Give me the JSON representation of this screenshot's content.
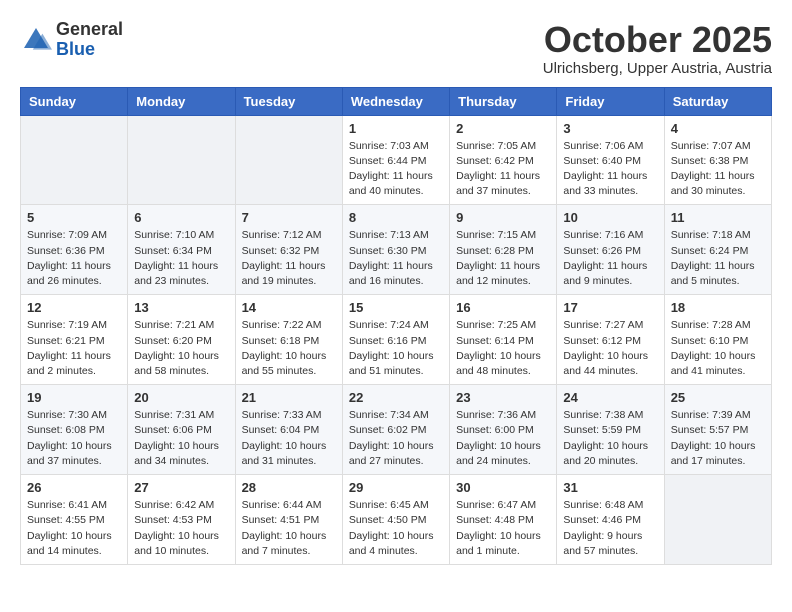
{
  "header": {
    "logo_general": "General",
    "logo_blue": "Blue",
    "month": "October 2025",
    "location": "Ulrichsberg, Upper Austria, Austria"
  },
  "weekdays": [
    "Sunday",
    "Monday",
    "Tuesday",
    "Wednesday",
    "Thursday",
    "Friday",
    "Saturday"
  ],
  "weeks": [
    [
      {
        "day": "",
        "info": ""
      },
      {
        "day": "",
        "info": ""
      },
      {
        "day": "",
        "info": ""
      },
      {
        "day": "1",
        "info": "Sunrise: 7:03 AM\nSunset: 6:44 PM\nDaylight: 11 hours\nand 40 minutes."
      },
      {
        "day": "2",
        "info": "Sunrise: 7:05 AM\nSunset: 6:42 PM\nDaylight: 11 hours\nand 37 minutes."
      },
      {
        "day": "3",
        "info": "Sunrise: 7:06 AM\nSunset: 6:40 PM\nDaylight: 11 hours\nand 33 minutes."
      },
      {
        "day": "4",
        "info": "Sunrise: 7:07 AM\nSunset: 6:38 PM\nDaylight: 11 hours\nand 30 minutes."
      }
    ],
    [
      {
        "day": "5",
        "info": "Sunrise: 7:09 AM\nSunset: 6:36 PM\nDaylight: 11 hours\nand 26 minutes."
      },
      {
        "day": "6",
        "info": "Sunrise: 7:10 AM\nSunset: 6:34 PM\nDaylight: 11 hours\nand 23 minutes."
      },
      {
        "day": "7",
        "info": "Sunrise: 7:12 AM\nSunset: 6:32 PM\nDaylight: 11 hours\nand 19 minutes."
      },
      {
        "day": "8",
        "info": "Sunrise: 7:13 AM\nSunset: 6:30 PM\nDaylight: 11 hours\nand 16 minutes."
      },
      {
        "day": "9",
        "info": "Sunrise: 7:15 AM\nSunset: 6:28 PM\nDaylight: 11 hours\nand 12 minutes."
      },
      {
        "day": "10",
        "info": "Sunrise: 7:16 AM\nSunset: 6:26 PM\nDaylight: 11 hours\nand 9 minutes."
      },
      {
        "day": "11",
        "info": "Sunrise: 7:18 AM\nSunset: 6:24 PM\nDaylight: 11 hours\nand 5 minutes."
      }
    ],
    [
      {
        "day": "12",
        "info": "Sunrise: 7:19 AM\nSunset: 6:21 PM\nDaylight: 11 hours\nand 2 minutes."
      },
      {
        "day": "13",
        "info": "Sunrise: 7:21 AM\nSunset: 6:20 PM\nDaylight: 10 hours\nand 58 minutes."
      },
      {
        "day": "14",
        "info": "Sunrise: 7:22 AM\nSunset: 6:18 PM\nDaylight: 10 hours\nand 55 minutes."
      },
      {
        "day": "15",
        "info": "Sunrise: 7:24 AM\nSunset: 6:16 PM\nDaylight: 10 hours\nand 51 minutes."
      },
      {
        "day": "16",
        "info": "Sunrise: 7:25 AM\nSunset: 6:14 PM\nDaylight: 10 hours\nand 48 minutes."
      },
      {
        "day": "17",
        "info": "Sunrise: 7:27 AM\nSunset: 6:12 PM\nDaylight: 10 hours\nand 44 minutes."
      },
      {
        "day": "18",
        "info": "Sunrise: 7:28 AM\nSunset: 6:10 PM\nDaylight: 10 hours\nand 41 minutes."
      }
    ],
    [
      {
        "day": "19",
        "info": "Sunrise: 7:30 AM\nSunset: 6:08 PM\nDaylight: 10 hours\nand 37 minutes."
      },
      {
        "day": "20",
        "info": "Sunrise: 7:31 AM\nSunset: 6:06 PM\nDaylight: 10 hours\nand 34 minutes."
      },
      {
        "day": "21",
        "info": "Sunrise: 7:33 AM\nSunset: 6:04 PM\nDaylight: 10 hours\nand 31 minutes."
      },
      {
        "day": "22",
        "info": "Sunrise: 7:34 AM\nSunset: 6:02 PM\nDaylight: 10 hours\nand 27 minutes."
      },
      {
        "day": "23",
        "info": "Sunrise: 7:36 AM\nSunset: 6:00 PM\nDaylight: 10 hours\nand 24 minutes."
      },
      {
        "day": "24",
        "info": "Sunrise: 7:38 AM\nSunset: 5:59 PM\nDaylight: 10 hours\nand 20 minutes."
      },
      {
        "day": "25",
        "info": "Sunrise: 7:39 AM\nSunset: 5:57 PM\nDaylight: 10 hours\nand 17 minutes."
      }
    ],
    [
      {
        "day": "26",
        "info": "Sunrise: 6:41 AM\nSunset: 4:55 PM\nDaylight: 10 hours\nand 14 minutes."
      },
      {
        "day": "27",
        "info": "Sunrise: 6:42 AM\nSunset: 4:53 PM\nDaylight: 10 hours\nand 10 minutes."
      },
      {
        "day": "28",
        "info": "Sunrise: 6:44 AM\nSunset: 4:51 PM\nDaylight: 10 hours\nand 7 minutes."
      },
      {
        "day": "29",
        "info": "Sunrise: 6:45 AM\nSunset: 4:50 PM\nDaylight: 10 hours\nand 4 minutes."
      },
      {
        "day": "30",
        "info": "Sunrise: 6:47 AM\nSunset: 4:48 PM\nDaylight: 10 hours\nand 1 minute."
      },
      {
        "day": "31",
        "info": "Sunrise: 6:48 AM\nSunset: 4:46 PM\nDaylight: 9 hours\nand 57 minutes."
      },
      {
        "day": "",
        "info": ""
      }
    ]
  ]
}
